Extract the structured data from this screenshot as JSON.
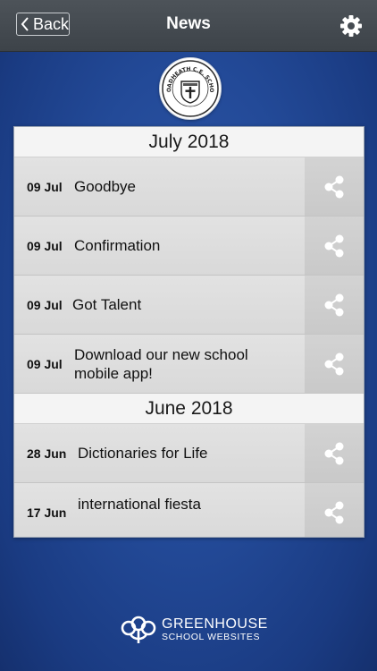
{
  "header": {
    "back_label": "Back",
    "title": "News"
  },
  "school_logo": {
    "text": "BROADHEATH C.E. SCHOOL"
  },
  "sections": [
    {
      "month": "July 2018",
      "items": [
        {
          "date": "09 Jul",
          "title": "Goodbye"
        },
        {
          "date": "09 Jul",
          "title": "Confirmation"
        },
        {
          "date": "09 Jul",
          "title": "Got Talent"
        },
        {
          "date": "09 Jul",
          "title": "Download our new school mobile app!"
        }
      ]
    },
    {
      "month": "June 2018",
      "items": [
        {
          "date": "28 Jun",
          "title": "Dictionaries for Life"
        },
        {
          "date": "17 Jun",
          "title": "international fiesta"
        }
      ]
    }
  ],
  "footer": {
    "line1": "GREENHOUSE",
    "line2": "SCHOOL WEBSITES"
  },
  "colors": {
    "background": "#234a98",
    "topbar": "#464c52",
    "share_icon": "#ffffff"
  }
}
